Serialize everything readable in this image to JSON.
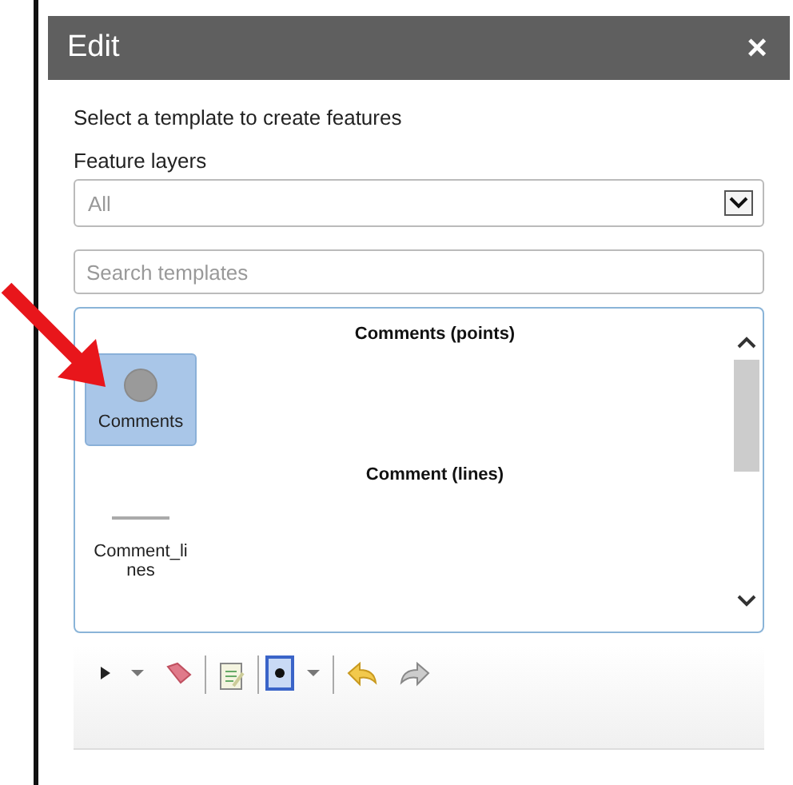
{
  "panel": {
    "title": "Edit",
    "close": "×"
  },
  "instruction": "Select a template to create features",
  "feature_layers": {
    "label": "Feature layers",
    "value": "All"
  },
  "search": {
    "placeholder": "Search templates"
  },
  "template_groups": [
    {
      "title": "Comments (points)",
      "items": [
        {
          "label": "Comments",
          "kind": "point",
          "selected": true
        }
      ]
    },
    {
      "title": "Comment (lines)",
      "items": [
        {
          "label": "Comment_lines",
          "kind": "line",
          "selected": false
        }
      ]
    }
  ],
  "toolbar": [
    {
      "kind": "select",
      "selected": false
    },
    {
      "kind": "caret",
      "selected": false
    },
    {
      "kind": "eraser",
      "selected": false
    },
    {
      "kind": "divider"
    },
    {
      "kind": "attributes",
      "selected": false
    },
    {
      "kind": "divider"
    },
    {
      "kind": "point",
      "selected": true
    },
    {
      "kind": "caret",
      "selected": false
    },
    {
      "kind": "divider"
    },
    {
      "kind": "undo",
      "selected": false
    },
    {
      "kind": "redo",
      "selected": false
    }
  ]
}
